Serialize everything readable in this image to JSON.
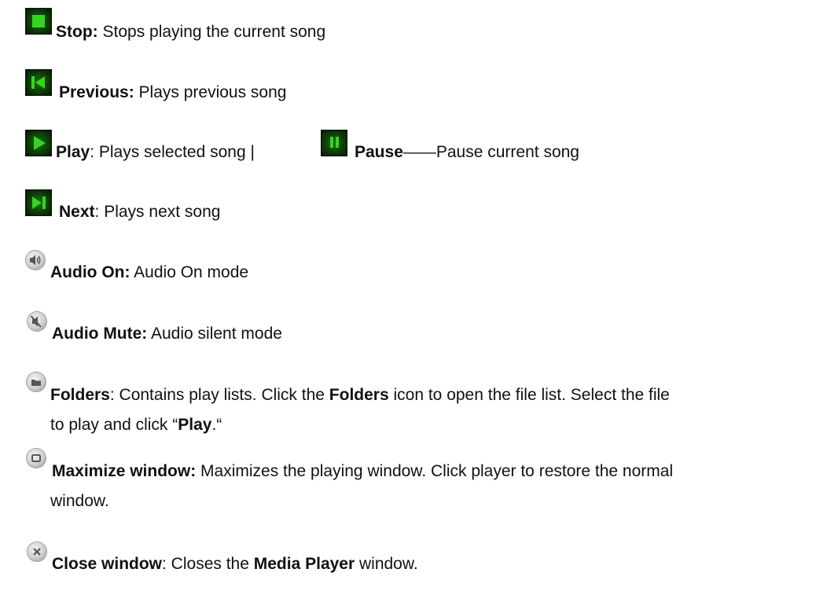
{
  "items": {
    "stop": {
      "icon": "stop-icon",
      "label": "Stop:",
      "desc": " Stops playing the current song"
    },
    "previous": {
      "icon": "previous-icon",
      "label": "Previous:",
      "desc": " Plays previous song"
    },
    "play": {
      "icon": "play-icon",
      "label": "Play",
      "desc": ":  Plays selected song  |",
      "pause_icon": "pause-icon",
      "pause_label": "Pause",
      "pause_desc": "——Pause current song"
    },
    "next": {
      "icon": "next-icon",
      "label": "Next",
      "desc": ":  Plays next song"
    },
    "audio_on": {
      "icon": "speaker-on-icon",
      "label": "Audio On:",
      "desc": "  Audio On mode"
    },
    "audio_mute": {
      "icon": "speaker-mute-icon",
      "label": "Audio Mute:",
      "desc": "  Audio silent mode"
    },
    "folders": {
      "icon": "folder-icon",
      "label": "Folders",
      "desc1": ":  Contains play lists. Click the ",
      "bold1": "Folders",
      "desc2": " icon to open the file list. Select the file",
      "line2_pre": "to play and click “",
      "bold2": "Play",
      "line2_post": ".“"
    },
    "maximize": {
      "icon": "maximize-icon",
      "label": "Maximize window:",
      "desc": "  Maximizes the playing window. Click player to restore the normal",
      "line2": "window."
    },
    "close": {
      "icon": "close-icon",
      "label": "Close window",
      "desc1": ":  Closes the ",
      "bold": "Media Player",
      "desc2": " window."
    }
  },
  "colors": {
    "button_green": "#2bd11c",
    "icon_grey": "#cfcfcf",
    "text": "#111111"
  }
}
